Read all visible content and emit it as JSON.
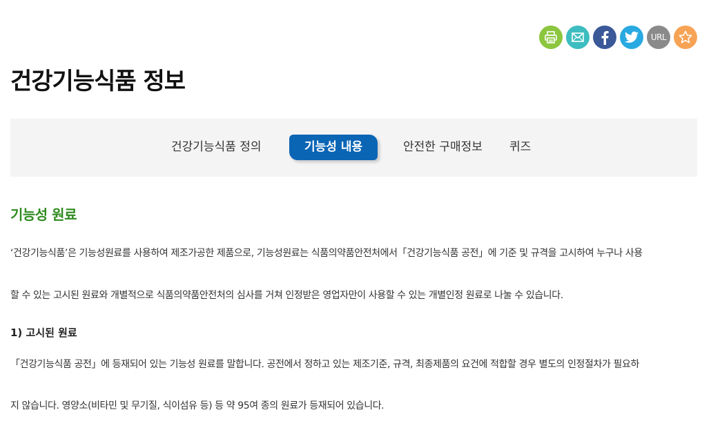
{
  "share": {
    "buttons": [
      {
        "name": "print",
        "icon": "print-icon",
        "color": "#8cc63f"
      },
      {
        "name": "email",
        "icon": "mail-icon",
        "color": "#3dbdbf"
      },
      {
        "name": "facebook",
        "icon": "facebook-icon",
        "color": "#3b5998"
      },
      {
        "name": "twitter",
        "icon": "twitter-icon",
        "color": "#29a9e1"
      },
      {
        "name": "url",
        "icon": "url-icon",
        "color": "#8a8a8a",
        "label": "URL"
      },
      {
        "name": "favorite",
        "icon": "star-icon",
        "color": "#f7a356"
      }
    ]
  },
  "page": {
    "title": "건강기능식품 정보"
  },
  "tabs": [
    {
      "label": "건강기능식품 정의",
      "active": false
    },
    {
      "label": "기능성 내용",
      "active": true
    },
    {
      "label": "안전한 구매정보",
      "active": false
    },
    {
      "label": "퀴즈",
      "active": false
    }
  ],
  "content": {
    "heading": "기능성 원료",
    "intro_lines": [
      "‘건강기능식품’은 기능성원료를 사용하여 제조가공한 제품으로, 기능성원료는 식품의약품안전처에서「건강기능식품 공전」에 기준 및 규격을 고시하여 누구나 사용",
      "할 수 있는 고시된 원료와 개별적으로 식품의약품안전처의 심사를 거쳐 인정받은 영업자만이 사용할 수 있는 개별인정 원료로 나눌 수 있습니다."
    ],
    "subheading": "1) 고시된 원료",
    "sub_lines": [
      "「건강기능식품 공전」에 등재되어 있는 기능성 원료를 말합니다. 공전에서 정하고 있는 제조기준, 규격, 최종제품의 요건에 적합할 경우 별도의 인정절차가 필요하",
      "지 않습니다. 영양소(비타민 및 무기질, 식이섬유 등) 등 약 95여 종의 원료가 등재되어 있습니다."
    ]
  }
}
